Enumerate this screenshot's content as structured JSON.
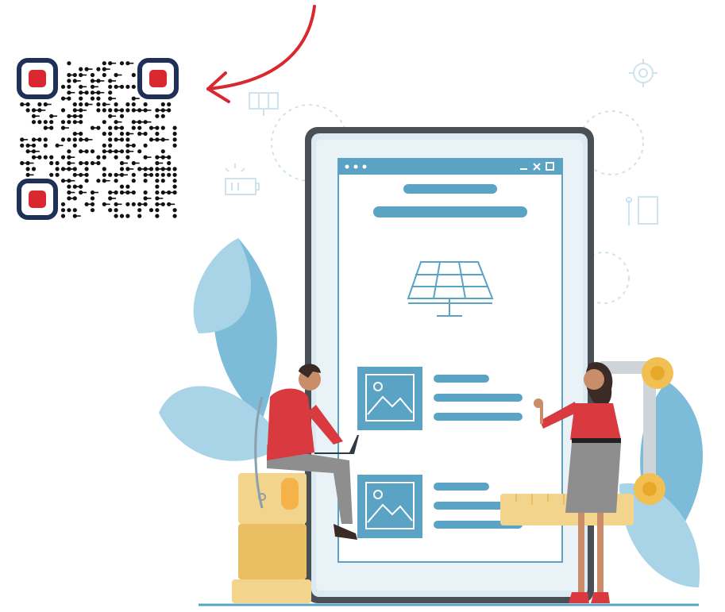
{
  "illustration": {
    "description_icons": [
      "qr-code-icon",
      "arrow-icon",
      "solar-panel-icon",
      "image-placeholder-icon",
      "battery-icon",
      "gear-icon",
      "calculator-icon",
      "lightbulb-icon"
    ],
    "window_controls": [
      "minimize-icon",
      "maximize-icon",
      "close-icon"
    ]
  },
  "colors": {
    "accent_red": "#d9282f",
    "qr_frame_navy": "#1e2f58",
    "screen_blue": "#5aa3c4",
    "leaf_blue": "#7cbcd8",
    "leaf_blue_light": "#a9d3e6",
    "sand": "#f2d48c",
    "sand_dark": "#e9bf62",
    "tablet_frame": "#4a4e55",
    "shirt_red": "#d83a3f",
    "pants_grey": "#8e8e8e"
  }
}
